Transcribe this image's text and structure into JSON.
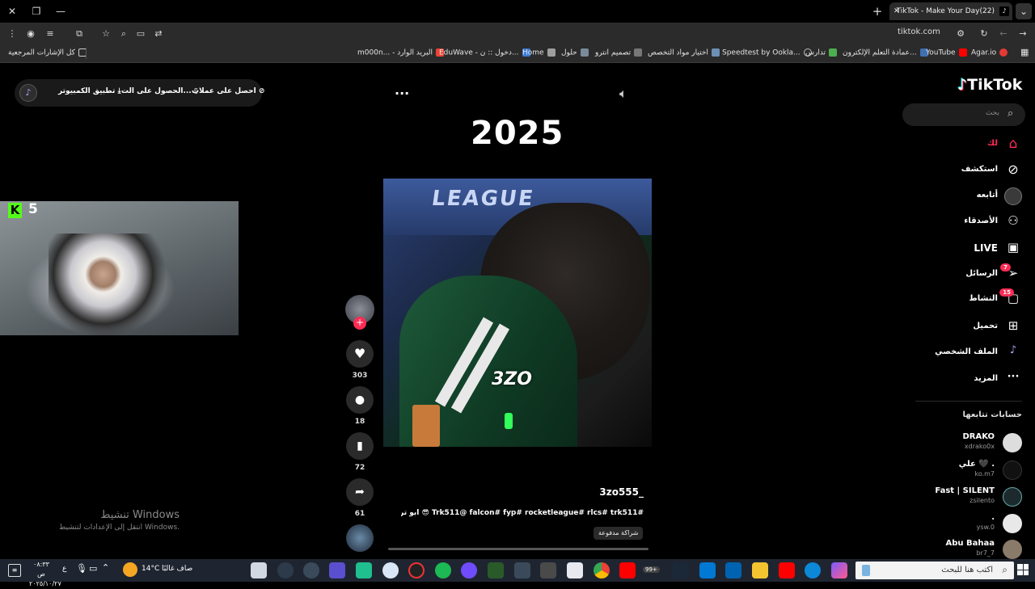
{
  "window": {
    "tab_title": "(22)TikTok - Make Your Day",
    "url": "tiktok.com"
  },
  "bookmarks": [
    {
      "label": "كل الإشارات المرجعية",
      "color": "#cccccc"
    },
    {
      "label": "m000n... - البريد الوارد",
      "color": "#ea4335"
    },
    {
      "label": "EduWave - دخول :: ن...",
      "color": "#3b7bd6"
    },
    {
      "label": "Home",
      "color": "#9e9e9e"
    },
    {
      "label": "حلول",
      "color": "#7a8a9a"
    },
    {
      "label": "تصميم انترو",
      "color": "#777777"
    },
    {
      "label": "اختيار مواد التخصص",
      "color": "#6c8fb5"
    },
    {
      "label": "Speedtest by Ookla...",
      "color": "#bbbbbb"
    },
    {
      "label": "تدارس",
      "color": "#4caf50"
    },
    {
      "label": "عمادة التعلم الإلكترون...",
      "color": "#3f6fb0"
    },
    {
      "label": "YouTube",
      "color": "#ff0000"
    },
    {
      "label": "Agar.io",
      "color": "#e53935"
    }
  ],
  "top_actions": {
    "coins": "احصل على عملات",
    "get_app": "الحصول على الت...",
    "desktop_app": "تطبيق الكمبيوتر"
  },
  "video": {
    "year_overlay": "2025",
    "watermark": "3ZO",
    "author": "3zo555_",
    "caption": "Trk511@ falcon# fyp# rocketleague# rlcs# trk511# 😎 ابو تريكه",
    "paid_tag": "شراكة مدفوعة"
  },
  "webcam": {
    "kick_count": "5"
  },
  "actions": {
    "likes": "303",
    "comments": "18",
    "saves": "72",
    "shares": "61"
  },
  "brand": {
    "logo": "TikTok",
    "accent": "#fe2c55"
  },
  "search": {
    "placeholder": "بحث"
  },
  "nav": {
    "for_you": "لك",
    "explore": "استكشف",
    "following": "أتابعه",
    "friends": "الأصدقاء",
    "live": "LIVE",
    "messages": "الرسائل",
    "messages_badge": "7",
    "activity": "النشاط",
    "activity_badge": "15",
    "upload": "تحميل",
    "profile": "الملف الشخصي",
    "more": "المزيد"
  },
  "following_section": {
    "title": "حسابات تتابعها",
    "accounts": [
      {
        "name": "DRAKO",
        "user": "xdrako0x"
      },
      {
        "name": "علي 🖤 .",
        "user": "ko.m7"
      },
      {
        "name": "Fast | SILENT",
        "user": "zsilento"
      },
      {
        "name": ".",
        "user": "ysw.0"
      },
      {
        "name": "Abu Bahaa",
        "user": "br7_7"
      }
    ]
  },
  "activation": {
    "title": "تنشيط Windows",
    "subtitle": "انتقل إلى الإعدادات لتنشيط Windows."
  },
  "taskbar": {
    "search": "اكتب هنا للبحث",
    "weather_temp": "14°C",
    "weather_text": "صاف غالبًا",
    "time": "٠٨:٣٣ ص",
    "date": "٢٠٢٥/١٠/٢٧",
    "lang": "ع",
    "notif": "99+"
  }
}
